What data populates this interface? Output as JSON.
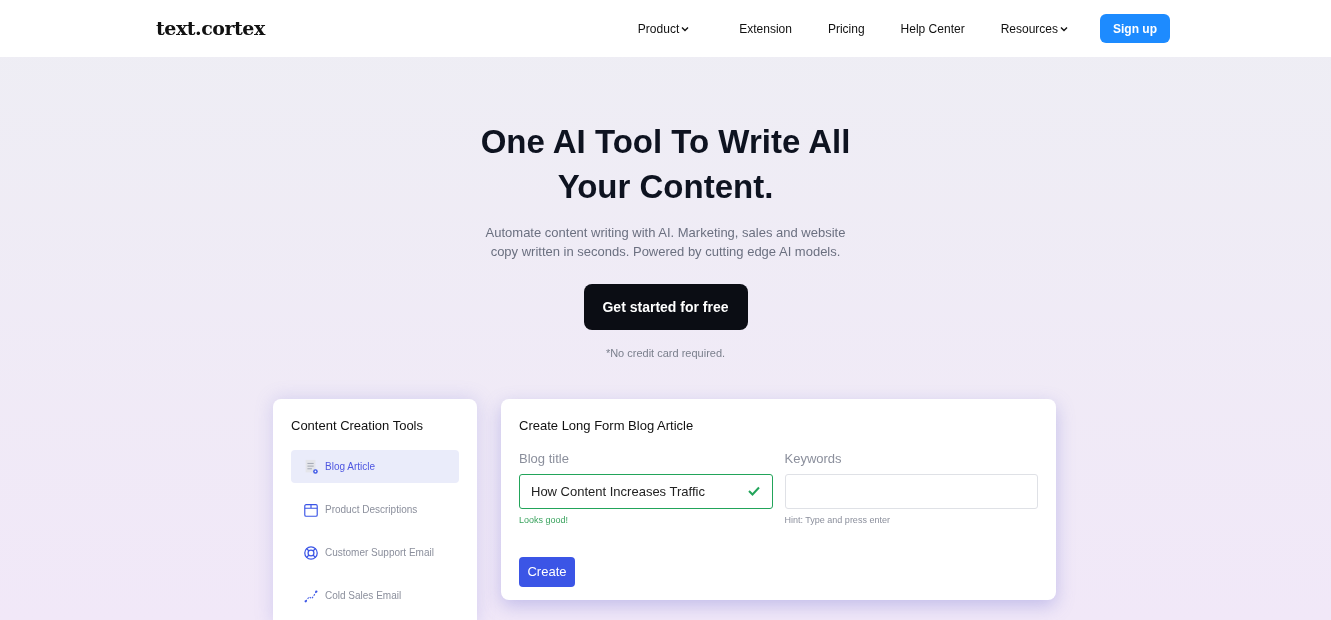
{
  "logo": "text.cortex",
  "nav": [
    {
      "label": "Product",
      "kind": "dropdown"
    },
    {
      "label": "Extension",
      "kind": "link"
    },
    {
      "label": "Pricing",
      "kind": "link"
    },
    {
      "label": "Help Center",
      "kind": "link"
    },
    {
      "label": "Resources",
      "kind": "dropdown"
    }
  ],
  "signup": "Sign up",
  "hero": {
    "title": "One AI Tool To Write All Your Content.",
    "subtitle": "Automate content writing with AI. Marketing, sales and website copy written in seconds. Powered by cutting edge AI models.",
    "cta": "Get started for free",
    "note": "*No credit card required."
  },
  "tools": {
    "title": "Content Creation Tools",
    "items": [
      {
        "label": "Blog Article",
        "kind": "document",
        "selected": true
      },
      {
        "label": "Product Descriptions",
        "kind": "box",
        "selected": false
      },
      {
        "label": "Customer Support Email",
        "kind": "lifebuoy",
        "selected": false
      },
      {
        "label": "Cold Sales Email",
        "kind": "trend",
        "selected": false
      }
    ]
  },
  "form": {
    "title": "Create Long Form Blog Article",
    "fields": [
      {
        "label": "Blog title",
        "value": "How Content Increases Traffic",
        "valid": true,
        "help": "Looks good!"
      },
      {
        "label": "Keywords",
        "valid": false,
        "help": "Hint: Type and press enter"
      }
    ],
    "button": "Create"
  }
}
